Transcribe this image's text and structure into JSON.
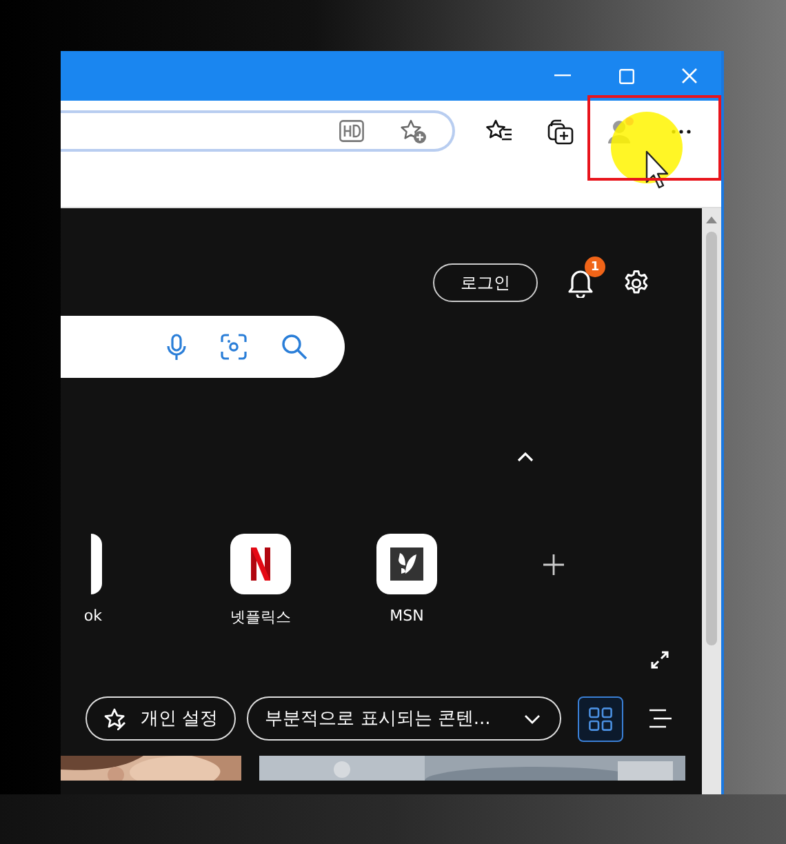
{
  "toolbar": {
    "profile": {
      "notification": true
    }
  },
  "page": {
    "login_button": "로그인",
    "notification_badge": "1",
    "quick_links": [
      {
        "kind": "partial",
        "label": "ok"
      },
      {
        "kind": "netflix",
        "label": "넷플릭스"
      },
      {
        "kind": "msn",
        "label": "MSN"
      },
      {
        "kind": "add"
      }
    ],
    "bottom_bar": {
      "personalize_button": "개인 설정",
      "content_dropdown": "부분적으로 표시되는 콘텐...",
      "views": [
        {
          "kind": "grid",
          "selected": true
        },
        {
          "kind": "list",
          "selected": false
        }
      ]
    }
  }
}
